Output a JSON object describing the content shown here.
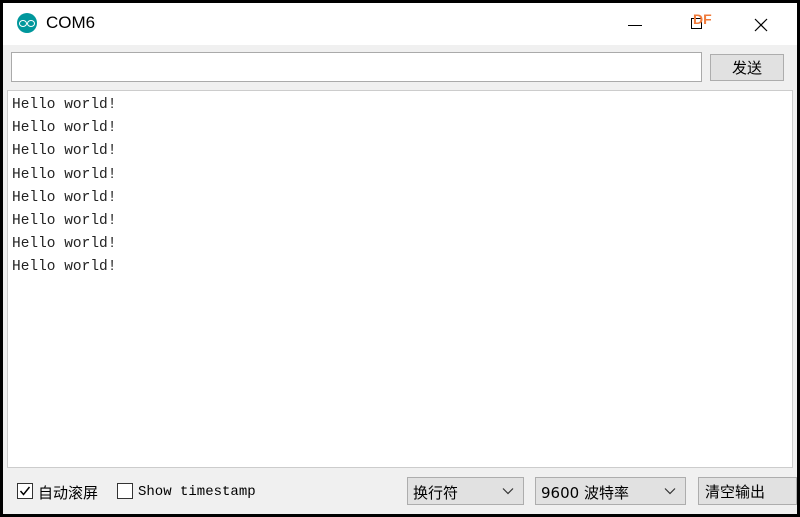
{
  "window": {
    "title": "COM6",
    "icon": "arduino-icon"
  },
  "watermark": "DF",
  "send": {
    "input_value": "",
    "input_placeholder": "",
    "button_label": "发送"
  },
  "output": {
    "lines": [
      "Hello world!",
      "Hello world!",
      "Hello world!",
      "Hello world!",
      "Hello world!",
      "Hello world!",
      "Hello world!",
      "Hello world!"
    ]
  },
  "status": {
    "autoscroll": {
      "label": "自动滚屏",
      "checked": true
    },
    "timestamp": {
      "label": "Show timestamp",
      "checked": false
    },
    "line_ending": {
      "selected": "换行符"
    },
    "baud_rate": {
      "selected": "9600 波特率"
    },
    "clear_label": "清空输出"
  },
  "colors": {
    "icon_teal": "#00979c",
    "watermark_orange": "#f07a3a",
    "window_bg": "#f0f0f0"
  }
}
